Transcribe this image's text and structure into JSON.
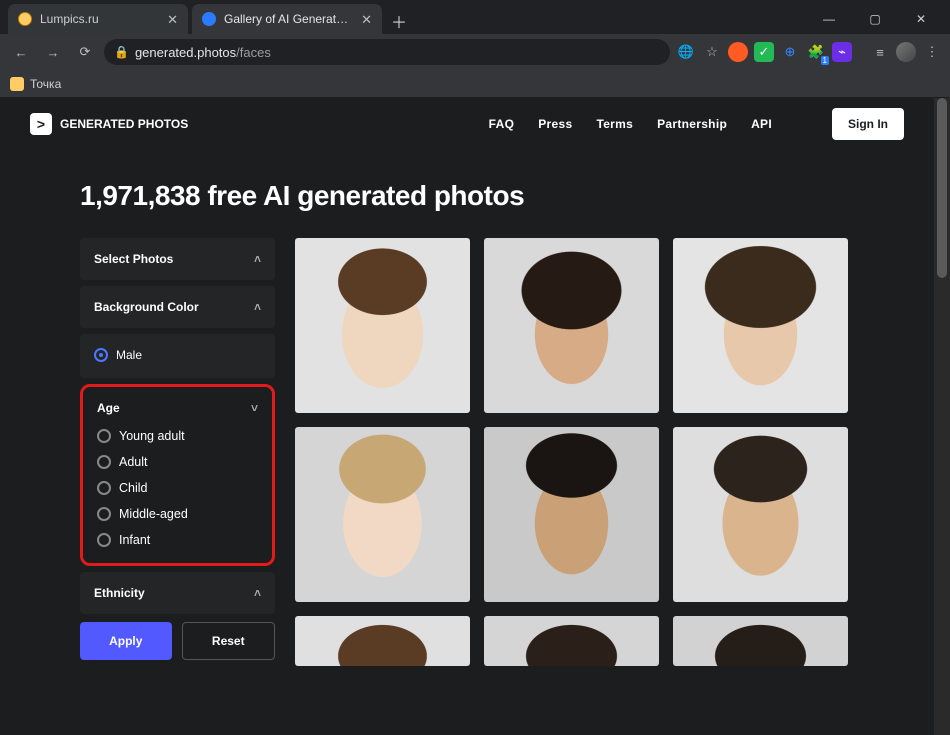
{
  "browser": {
    "tabs": [
      {
        "title": "Lumpics.ru"
      },
      {
        "title": "Gallery of AI Generated Faces | G…"
      }
    ],
    "url_host": "generated.photos",
    "url_path": "/faces",
    "bookmark": "Точка"
  },
  "header": {
    "brand": "GENERATED PHOTOS",
    "nav": {
      "faq": "FAQ",
      "press": "Press",
      "terms": "Terms",
      "partnership": "Partnership",
      "api": "API"
    },
    "signin": "Sign In"
  },
  "hero": {
    "title": "1,971,838 free AI generated photos"
  },
  "filters": {
    "select_photos": "Select Photos",
    "bg_color": "Background Color",
    "gender": {
      "male": "Male"
    },
    "age": {
      "label": "Age",
      "options": {
        "young_adult": "Young adult",
        "adult": "Adult",
        "child": "Child",
        "middle_aged": "Middle-aged",
        "infant": "Infant"
      }
    },
    "ethnicity": "Ethnicity",
    "apply": "Apply",
    "reset": "Reset"
  }
}
